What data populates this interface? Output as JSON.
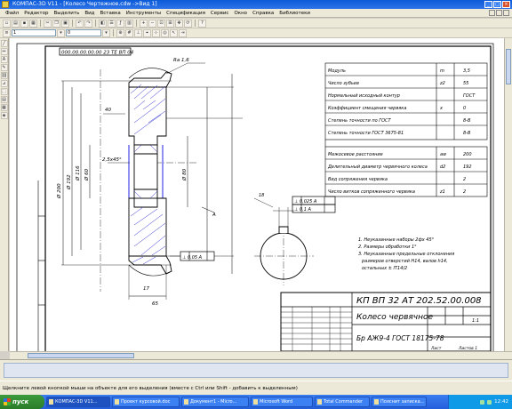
{
  "window": {
    "title": "КОМПАС-3D V11 - [Колесо Чертежное.cdw ->Вид 1]",
    "buttons": [
      "_",
      "□",
      "×"
    ]
  },
  "menu": {
    "items": [
      "Файл",
      "Редактор",
      "Выделить",
      "Вид",
      "Вставка",
      "Инструменты",
      "Спецификация",
      "Сервис",
      "Окно",
      "Справка",
      "Библиотеки"
    ]
  },
  "toolbar2": {
    "layer_value": "1",
    "style_value": "0"
  },
  "drawing": {
    "stamp_top": "000.00.00.00.00 23 ТЕ ВП 04",
    "params": [
      {
        "name": "Модуль",
        "sym": "m",
        "val": "3,5"
      },
      {
        "name": "Число зубьев",
        "sym": "z2",
        "val": "55"
      },
      {
        "name": "Нормальный исходный контур",
        "sym": "",
        "val": "ГОСТ"
      },
      {
        "name": "Коэффициент смещения червяка",
        "sym": "x",
        "val": "0"
      },
      {
        "name": "Степень точности по ГОСТ",
        "sym": "",
        "val": "8-В"
      },
      {
        "name": "Степень точности ГОСТ 3675-81",
        "sym": "",
        "val": "8-В"
      }
    ],
    "params2": [
      {
        "name": "Межосевое расстояние",
        "sym": "aw",
        "val": "200"
      },
      {
        "name": "Делительный диаметр червячного колеса",
        "sym": "d2",
        "val": "192"
      },
      {
        "name": "Вид сопряжения червяка",
        "sym": "",
        "val": "2"
      },
      {
        "name": "Число витков сопряженного червяка",
        "sym": "z1",
        "val": "2"
      }
    ],
    "notes": [
      "1. Неуказанные наборы 2фх 45°",
      "2. Размеры обработки 1°",
      "3. Неуказанные предельные отклонения",
      "размеров отверстий Н14, валов h14,",
      "остальных ± IT14/2"
    ],
    "tol1": "⊥ 0,025 A",
    "tol2": "⊥ 0,1 A",
    "tol_bottom": "⊥ 0,05 A",
    "title_code": "КП ВП 32 АТ 202.52.00.008",
    "part_name": "Колесо червячное",
    "material": "Бр АЖ9-4 ГОСТ 18175-78",
    "scale": "1:1",
    "sheet_label": "Лист",
    "sheets_label": "Листов 1",
    "dims": {
      "ra": "Ra 1,6",
      "d1": "Ø 200",
      "d2": "Ø 192",
      "d3": "Ø 60",
      "d4": "Ø 116",
      "d5": "Ø 80",
      "w1": "40",
      "w2": "17",
      "a1": "2,5x45°",
      "letter": "A",
      "bottom": "65",
      "key": "18"
    }
  },
  "status": {
    "text": "Щелкните левой кнопкой мыши на объекте для его выделения (вместе с Ctrl или Shift - добавить к выделенным)"
  },
  "taskbar": {
    "start": "пуск",
    "tasks": [
      "КОМПАС-3D V11...",
      "Проект курсовой.doc",
      "Документ1 - Micro...",
      "Microsoft Word",
      "Total Commander",
      "Пояснит записка..."
    ],
    "clock": "12:42"
  }
}
